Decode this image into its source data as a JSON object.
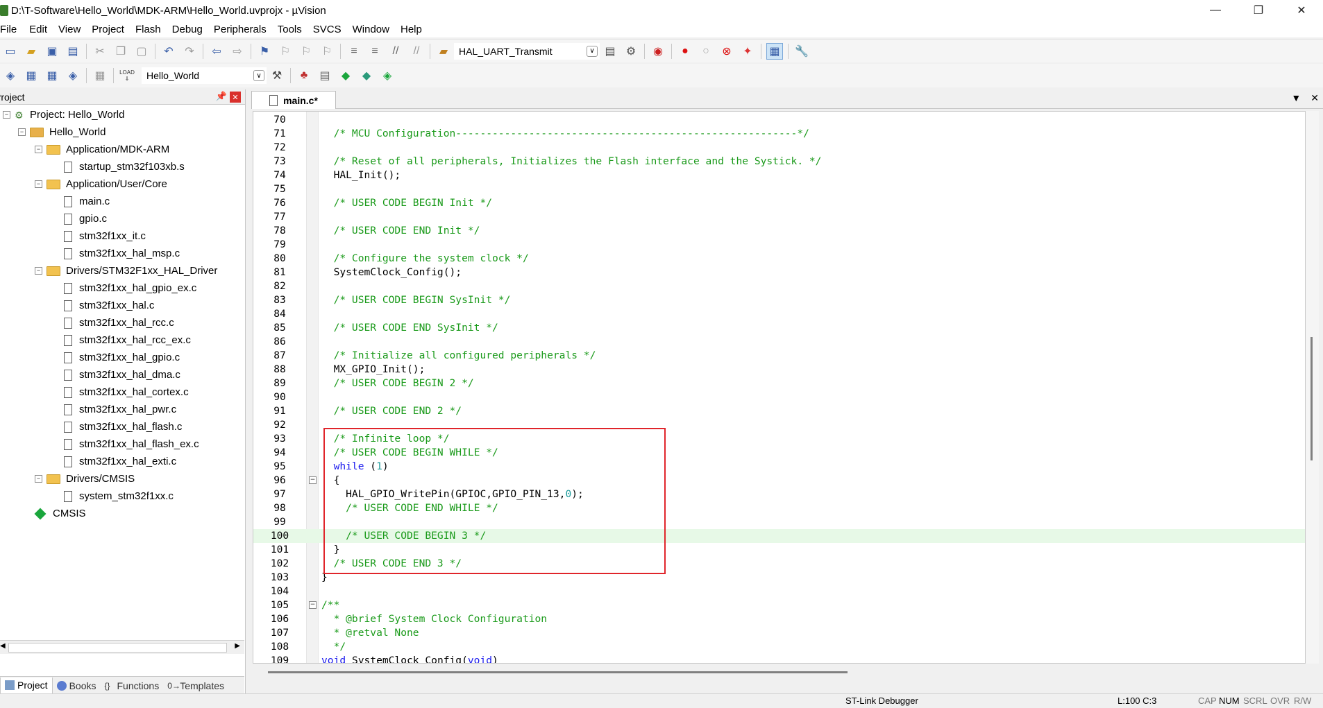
{
  "window": {
    "title": "D:\\T-Software\\Hello_World\\MDK-ARM\\Hello_World.uvprojx - µVision",
    "minimize": "—",
    "maximize": "❐",
    "close": "✕"
  },
  "menu": [
    "File",
    "Edit",
    "View",
    "Project",
    "Flash",
    "Debug",
    "Peripherals",
    "Tools",
    "SVCS",
    "Window",
    "Help"
  ],
  "toolbar": {
    "find_combo": "HAL_UART_Transmit",
    "target_combo": "Hello_World",
    "load_label": "LOAD"
  },
  "project_panel": {
    "header": "Project",
    "tree": [
      {
        "label": "Project: Hello_World",
        "depth": 0,
        "type": "project",
        "toggle": "−"
      },
      {
        "label": "Hello_World",
        "depth": 1,
        "type": "target",
        "toggle": "−"
      },
      {
        "label": "Application/MDK-ARM",
        "depth": 2,
        "type": "folder",
        "toggle": "−"
      },
      {
        "label": "startup_stm32f103xb.s",
        "depth": 3,
        "type": "file"
      },
      {
        "label": "Application/User/Core",
        "depth": 2,
        "type": "folder",
        "toggle": "−"
      },
      {
        "label": "main.c",
        "depth": 3,
        "type": "file"
      },
      {
        "label": "gpio.c",
        "depth": 3,
        "type": "file"
      },
      {
        "label": "stm32f1xx_it.c",
        "depth": 3,
        "type": "file"
      },
      {
        "label": "stm32f1xx_hal_msp.c",
        "depth": 3,
        "type": "file"
      },
      {
        "label": "Drivers/STM32F1xx_HAL_Driver",
        "depth": 2,
        "type": "folder",
        "toggle": "−"
      },
      {
        "label": "stm32f1xx_hal_gpio_ex.c",
        "depth": 3,
        "type": "file"
      },
      {
        "label": "stm32f1xx_hal.c",
        "depth": 3,
        "type": "file"
      },
      {
        "label": "stm32f1xx_hal_rcc.c",
        "depth": 3,
        "type": "file"
      },
      {
        "label": "stm32f1xx_hal_rcc_ex.c",
        "depth": 3,
        "type": "file"
      },
      {
        "label": "stm32f1xx_hal_gpio.c",
        "depth": 3,
        "type": "file"
      },
      {
        "label": "stm32f1xx_hal_dma.c",
        "depth": 3,
        "type": "file"
      },
      {
        "label": "stm32f1xx_hal_cortex.c",
        "depth": 3,
        "type": "file"
      },
      {
        "label": "stm32f1xx_hal_pwr.c",
        "depth": 3,
        "type": "file"
      },
      {
        "label": "stm32f1xx_hal_flash.c",
        "depth": 3,
        "type": "file"
      },
      {
        "label": "stm32f1xx_hal_flash_ex.c",
        "depth": 3,
        "type": "file"
      },
      {
        "label": "stm32f1xx_hal_exti.c",
        "depth": 3,
        "type": "file"
      },
      {
        "label": "Drivers/CMSIS",
        "depth": 2,
        "type": "folder",
        "toggle": "−"
      },
      {
        "label": "system_stm32f1xx.c",
        "depth": 3,
        "type": "file"
      },
      {
        "label": "CMSIS",
        "depth": 2,
        "type": "gem"
      }
    ],
    "tabs": [
      {
        "label": "Project",
        "icon": "project-icon",
        "active": true
      },
      {
        "label": "Books",
        "icon": "books-icon"
      },
      {
        "label": "Functions",
        "icon": "functions-icon",
        "glyph": "{}"
      },
      {
        "label": "Templates",
        "icon": "templates-icon",
        "glyph": "0→"
      }
    ]
  },
  "editor": {
    "tab_label": "main.c*",
    "lines": [
      {
        "n": "70",
        "parts": []
      },
      {
        "n": "71",
        "parts": [
          {
            "t": "  /* MCU Configuration--------------------------------------------------------*/",
            "c": "cm"
          }
        ]
      },
      {
        "n": "72",
        "parts": []
      },
      {
        "n": "73",
        "parts": [
          {
            "t": "  /* Reset of all peripherals, Initializes the Flash interface and the Systick. */",
            "c": "cm"
          }
        ]
      },
      {
        "n": "74",
        "parts": [
          {
            "t": "  HAL_Init();",
            "c": ""
          }
        ]
      },
      {
        "n": "75",
        "parts": []
      },
      {
        "n": "76",
        "parts": [
          {
            "t": "  /* USER CODE BEGIN Init */",
            "c": "cm"
          }
        ]
      },
      {
        "n": "77",
        "parts": []
      },
      {
        "n": "78",
        "parts": [
          {
            "t": "  /* USER CODE END Init */",
            "c": "cm"
          }
        ]
      },
      {
        "n": "79",
        "parts": []
      },
      {
        "n": "80",
        "parts": [
          {
            "t": "  /* Configure the system clock */",
            "c": "cm"
          }
        ]
      },
      {
        "n": "81",
        "parts": [
          {
            "t": "  SystemClock_Config();",
            "c": ""
          }
        ]
      },
      {
        "n": "82",
        "parts": []
      },
      {
        "n": "83",
        "parts": [
          {
            "t": "  /* USER CODE BEGIN SysInit */",
            "c": "cm"
          }
        ]
      },
      {
        "n": "84",
        "parts": []
      },
      {
        "n": "85",
        "parts": [
          {
            "t": "  /* USER CODE END SysInit */",
            "c": "cm"
          }
        ]
      },
      {
        "n": "86",
        "parts": []
      },
      {
        "n": "87",
        "parts": [
          {
            "t": "  /* Initialize all configured peripherals */",
            "c": "cm"
          }
        ]
      },
      {
        "n": "88",
        "parts": [
          {
            "t": "  MX_GPIO_Init();",
            "c": ""
          }
        ]
      },
      {
        "n": "89",
        "parts": [
          {
            "t": "  /* USER CODE BEGIN 2 */",
            "c": "cm"
          }
        ]
      },
      {
        "n": "90",
        "parts": []
      },
      {
        "n": "91",
        "parts": [
          {
            "t": "  /* USER CODE END 2 */",
            "c": "cm"
          }
        ]
      },
      {
        "n": "92",
        "parts": []
      },
      {
        "n": "93",
        "parts": [
          {
            "t": "  /* Infinite loop */",
            "c": "cm"
          }
        ]
      },
      {
        "n": "94",
        "parts": [
          {
            "t": "  /* USER CODE BEGIN WHILE */",
            "c": "cm"
          }
        ]
      },
      {
        "n": "95",
        "parts": [
          {
            "t": "  ",
            "c": ""
          },
          {
            "t": "while",
            "c": "kw"
          },
          {
            "t": " (",
            "c": ""
          },
          {
            "t": "1",
            "c": "num"
          },
          {
            "t": ")",
            "c": ""
          }
        ]
      },
      {
        "n": "96",
        "parts": [
          {
            "t": "  {",
            "c": ""
          }
        ],
        "fold": "−"
      },
      {
        "n": "97",
        "parts": [
          {
            "t": "    HAL_GPIO_WritePin(GPIOC,GPIO_PIN_13,",
            "c": ""
          },
          {
            "t": "0",
            "c": "num"
          },
          {
            "t": ");",
            "c": ""
          }
        ]
      },
      {
        "n": "98",
        "parts": [
          {
            "t": "    /* USER CODE END WHILE */",
            "c": "cm"
          }
        ]
      },
      {
        "n": "99",
        "parts": []
      },
      {
        "n": "100",
        "parts": [
          {
            "t": "    /* USER CODE BEGIN 3 */",
            "c": "cm"
          }
        ],
        "hl": true
      },
      {
        "n": "101",
        "parts": [
          {
            "t": "  }",
            "c": ""
          }
        ]
      },
      {
        "n": "102",
        "parts": [
          {
            "t": "  /* USER CODE END 3 */",
            "c": "cm"
          }
        ]
      },
      {
        "n": "103",
        "parts": [
          {
            "t": "}",
            "c": ""
          }
        ]
      },
      {
        "n": "104",
        "parts": []
      },
      {
        "n": "105",
        "parts": [
          {
            "t": "/**",
            "c": "cm"
          }
        ],
        "fold": "−"
      },
      {
        "n": "106",
        "parts": [
          {
            "t": "  * @brief System Clock Configuration",
            "c": "cm"
          }
        ]
      },
      {
        "n": "107",
        "parts": [
          {
            "t": "  * @retval None",
            "c": "cm"
          }
        ]
      },
      {
        "n": "108",
        "parts": [
          {
            "t": "  */",
            "c": "cm"
          }
        ]
      },
      {
        "n": "109",
        "parts": [
          {
            "t": "void",
            "c": "kw"
          },
          {
            "t": " SystemClock_Config(",
            "c": ""
          },
          {
            "t": "void",
            "c": "kw"
          },
          {
            "t": ")",
            "c": ""
          }
        ]
      }
    ]
  },
  "status": {
    "debugger": "ST-Link Debugger",
    "position": "L:100 C:3",
    "cap": "CAP",
    "num": "NUM",
    "scrl": "SCRL",
    "ovr": "OVR",
    "rw": "R/W"
  }
}
